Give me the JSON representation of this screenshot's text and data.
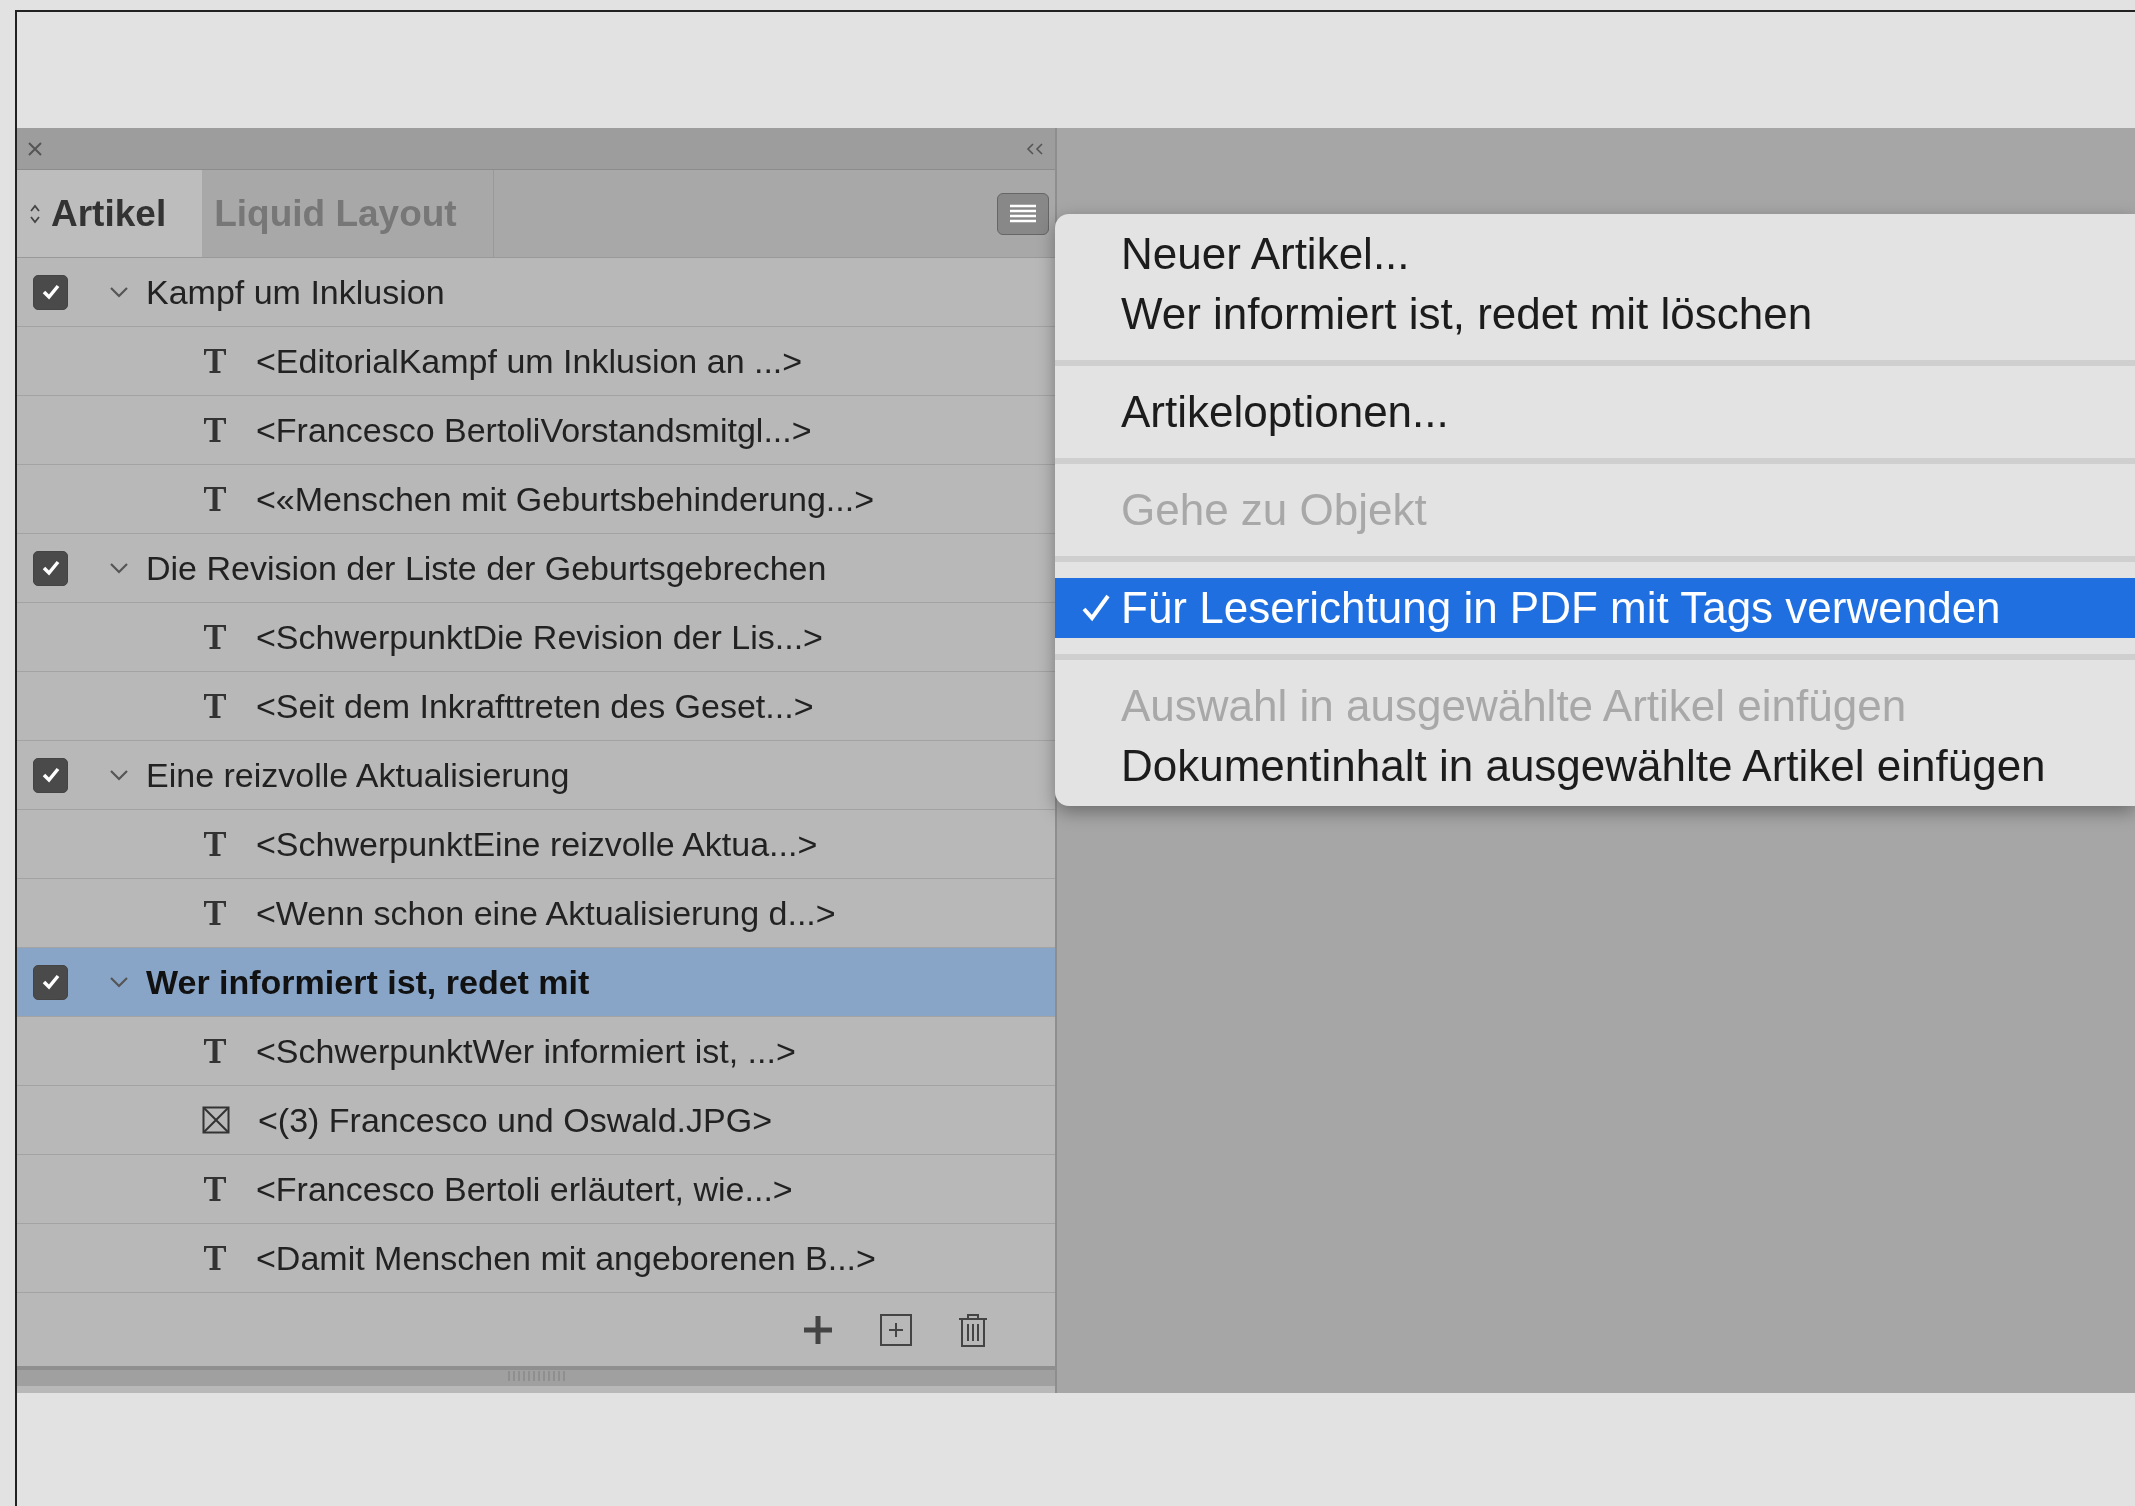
{
  "tabs": [
    {
      "label": "Artikel",
      "selected": true
    },
    {
      "label": "Liquid Layout",
      "selected": false
    }
  ],
  "articles": [
    {
      "title": "Kampf um Inklusion",
      "checked": true,
      "expanded": true,
      "selected": false,
      "children": [
        {
          "kind": "text",
          "label": "<EditorialKampf um Inklusion an ...>"
        },
        {
          "kind": "text",
          "label": "<Francesco BertoliVorstandsmitgl...>"
        },
        {
          "kind": "text",
          "label": "<«Menschen mit Geburtsbehinderung...>"
        }
      ]
    },
    {
      "title": "Die Revision der Liste der Geburtsgebrechen",
      "checked": true,
      "expanded": true,
      "selected": false,
      "children": [
        {
          "kind": "text",
          "label": "<SchwerpunktDie Revision der Lis...>"
        },
        {
          "kind": "text",
          "label": "<Seit dem Inkrafttreten des Geset...>"
        }
      ]
    },
    {
      "title": "Eine reizvolle Aktualisierung",
      "checked": true,
      "expanded": true,
      "selected": false,
      "children": [
        {
          "kind": "text",
          "label": "<SchwerpunktEine reizvolle Aktua...>"
        },
        {
          "kind": "text",
          "label": "<Wenn schon eine Aktualisierung d...>"
        }
      ]
    },
    {
      "title": "Wer informiert ist, redet mit",
      "checked": true,
      "expanded": true,
      "selected": true,
      "children": [
        {
          "kind": "text",
          "label": "<SchwerpunktWer informiert ist, ...>"
        },
        {
          "kind": "image",
          "label": "<(3) Francesco und Oswald.JPG>"
        },
        {
          "kind": "text",
          "label": "<Francesco Bertoli erläutert, wie...>"
        },
        {
          "kind": "text",
          "label": "<Damit Menschen mit angeborenen B...>"
        }
      ]
    }
  ],
  "menu": [
    {
      "kind": "item",
      "label": "Neuer Artikel...",
      "disabled": false,
      "checked": false,
      "selected": false
    },
    {
      "kind": "item",
      "label": "Wer informiert ist, redet mit löschen",
      "disabled": false,
      "checked": false,
      "selected": false
    },
    {
      "kind": "separator"
    },
    {
      "kind": "item",
      "label": "Artikeloptionen...",
      "disabled": false,
      "checked": false,
      "selected": false
    },
    {
      "kind": "separator"
    },
    {
      "kind": "item",
      "label": "Gehe zu Objekt",
      "disabled": true,
      "checked": false,
      "selected": false
    },
    {
      "kind": "separator"
    },
    {
      "kind": "item",
      "label": "Für Leserichtung in PDF mit Tags verwenden",
      "disabled": false,
      "checked": true,
      "selected": true
    },
    {
      "kind": "separator"
    },
    {
      "kind": "item",
      "label": "Auswahl in ausgewählte Artikel einfügen",
      "disabled": true,
      "checked": false,
      "selected": false
    },
    {
      "kind": "item",
      "label": "Dokumentinhalt in ausgewählte Artikel einfügen",
      "disabled": false,
      "checked": false,
      "selected": false
    }
  ]
}
